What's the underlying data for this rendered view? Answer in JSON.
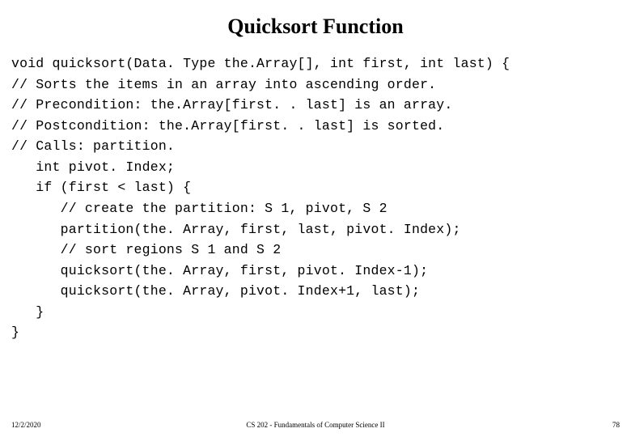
{
  "title": "Quicksort Function",
  "code": "void quicksort(Data. Type the.Array[], int first, int last) {\n// Sorts the items in an array into ascending order.\n// Precondition: the.Array[first. . last] is an array.\n// Postcondition: the.Array[first. . last] is sorted.\n// Calls: partition.\n   int pivot. Index;\n   if (first < last) {\n      // create the partition: S 1, pivot, S 2\n      partition(the. Array, first, last, pivot. Index);\n      // sort regions S 1 and S 2\n      quicksort(the. Array, first, pivot. Index-1);\n      quicksort(the. Array, pivot. Index+1, last);\n   }\n}",
  "footer": {
    "date": "12/2/2020",
    "center": "CS 202 - Fundamentals of Computer Science II",
    "page": "78"
  }
}
